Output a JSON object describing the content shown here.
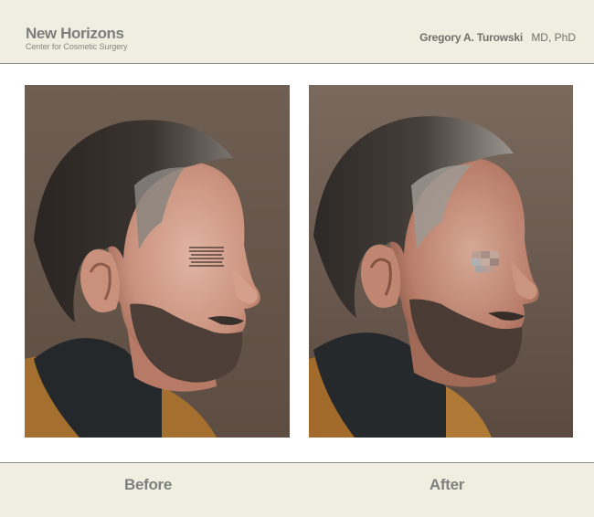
{
  "header": {
    "brand_name": "New Horizons",
    "brand_subtitle": "Center for Cosmetic Surgery",
    "doctor_name": "Gregory A. Turowski",
    "doctor_credentials": "MD, PhD"
  },
  "photos": [
    {
      "label": "Before",
      "subject": "profile-photo"
    },
    {
      "label": "After",
      "subject": "profile-photo"
    }
  ],
  "colors": {
    "band_background": "#efeee0",
    "band_border": "#8f8f88",
    "text_gray": "#7f817e",
    "photo_background": "#6b5a4e"
  }
}
